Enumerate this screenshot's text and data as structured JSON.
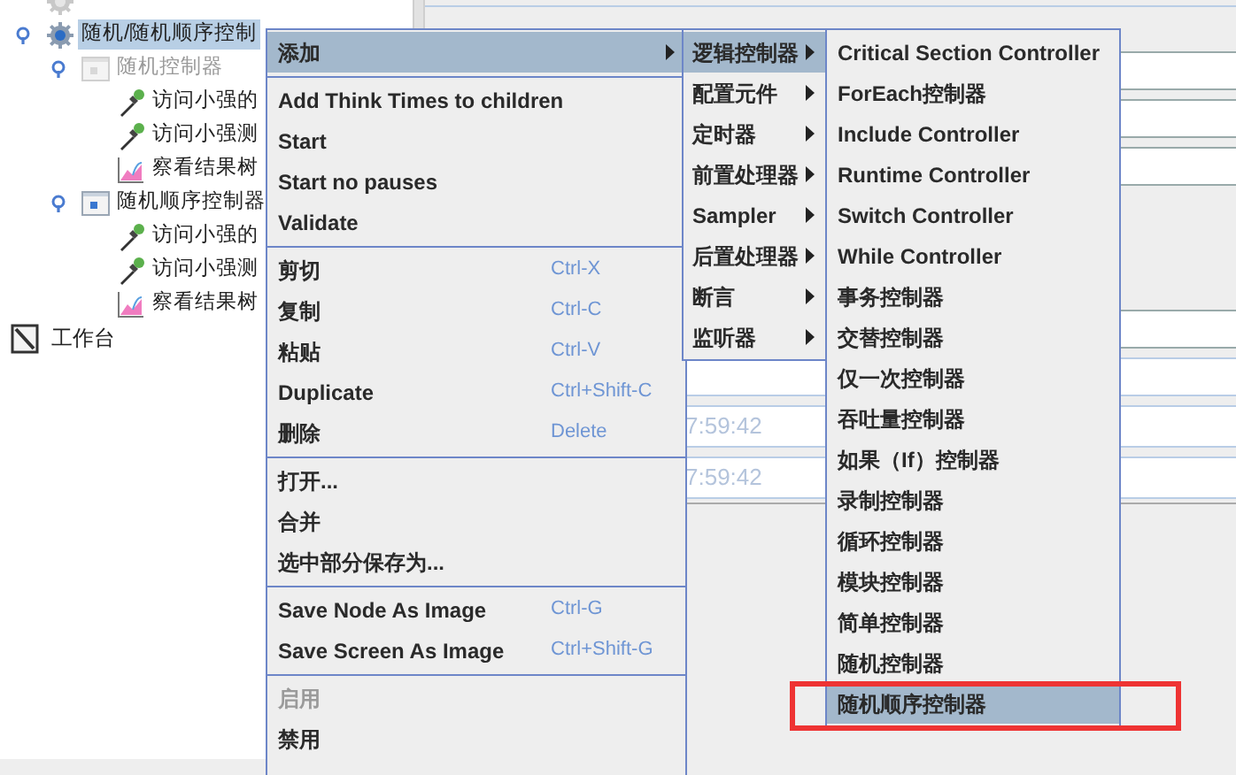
{
  "tree": {
    "items": [
      {
        "kind": "gear",
        "disabled": true
      },
      {
        "label": "随机/随机顺序控制",
        "kind": "gear",
        "disabled": false,
        "selected": true,
        "children": [
          {
            "label": "随机控制器",
            "kind": "controller",
            "disabled": true,
            "selected": false,
            "children": [
              {
                "label": "访问小强的",
                "kind": "sampler",
                "disabled": false,
                "selected": false
              },
              {
                "label": "访问小强测",
                "kind": "sampler",
                "disabled": false,
                "selected": false
              },
              {
                "label": "察看结果树",
                "kind": "listener",
                "disabled": false,
                "selected": false
              }
            ]
          },
          {
            "label": "随机顺序控制器",
            "kind": "controller",
            "disabled": false,
            "selected": false,
            "children": [
              {
                "label": "访问小强的",
                "kind": "sampler",
                "disabled": false,
                "selected": false
              },
              {
                "label": "访问小强测",
                "kind": "sampler",
                "disabled": false,
                "selected": false
              },
              {
                "label": "察看结果树",
                "kind": "listener",
                "disabled": false,
                "selected": false
              }
            ]
          }
        ]
      }
    ],
    "workbench": {
      "label": "工作台",
      "kind": "workbench"
    }
  },
  "details": {
    "times": [
      "7:59:42",
      "7:59:42"
    ]
  },
  "menus": [
    {
      "items": [
        {
          "kind": "item",
          "label": "添加",
          "submenu": true,
          "selected": true,
          "disabled": false
        },
        {
          "kind": "separator"
        },
        {
          "kind": "item",
          "label": "Add Think Times to children",
          "submenu": false,
          "selected": false,
          "disabled": false
        },
        {
          "kind": "item",
          "label": "Start",
          "submenu": false,
          "selected": false,
          "disabled": false
        },
        {
          "kind": "item",
          "label": "Start no pauses",
          "submenu": false,
          "selected": false,
          "disabled": false
        },
        {
          "kind": "item",
          "label": "Validate",
          "submenu": false,
          "selected": false,
          "disabled": false
        },
        {
          "kind": "separator"
        },
        {
          "kind": "item",
          "label": "剪切",
          "shortcut": "Ctrl-X",
          "submenu": false,
          "selected": false,
          "disabled": false
        },
        {
          "kind": "item",
          "label": "复制",
          "shortcut": "Ctrl-C",
          "submenu": false,
          "selected": false,
          "disabled": false
        },
        {
          "kind": "item",
          "label": "粘贴",
          "shortcut": "Ctrl-V",
          "submenu": false,
          "selected": false,
          "disabled": false
        },
        {
          "kind": "item",
          "label": "Duplicate",
          "shortcut": "Ctrl+Shift-C",
          "submenu": false,
          "selected": false,
          "disabled": false
        },
        {
          "kind": "item",
          "label": "删除",
          "shortcut": "Delete",
          "submenu": false,
          "selected": false,
          "disabled": false
        },
        {
          "kind": "separator"
        },
        {
          "kind": "item",
          "label": "打开...",
          "submenu": false,
          "selected": false,
          "disabled": false
        },
        {
          "kind": "item",
          "label": "合并",
          "submenu": false,
          "selected": false,
          "disabled": false
        },
        {
          "kind": "item",
          "label": "选中部分保存为...",
          "submenu": false,
          "selected": false,
          "disabled": false
        },
        {
          "kind": "separator"
        },
        {
          "kind": "item",
          "label": "Save Node As Image",
          "shortcut": "Ctrl-G",
          "submenu": false,
          "selected": false,
          "disabled": false
        },
        {
          "kind": "item",
          "label": "Save Screen As Image",
          "shortcut": "Ctrl+Shift-G",
          "submenu": false,
          "selected": false,
          "disabled": false
        },
        {
          "kind": "separator"
        },
        {
          "kind": "item",
          "label": "启用",
          "submenu": false,
          "selected": false,
          "disabled": true
        },
        {
          "kind": "item",
          "label": "禁用",
          "submenu": false,
          "selected": false,
          "disabled": false
        }
      ]
    },
    {
      "items": [
        {
          "kind": "item",
          "label": "逻辑控制器",
          "submenu": true,
          "selected": true,
          "disabled": false
        },
        {
          "kind": "item",
          "label": "配置元件",
          "submenu": true,
          "selected": false,
          "disabled": false
        },
        {
          "kind": "item",
          "label": "定时器",
          "submenu": true,
          "selected": false,
          "disabled": false
        },
        {
          "kind": "item",
          "label": "前置处理器",
          "submenu": true,
          "selected": false,
          "disabled": false
        },
        {
          "kind": "item",
          "label": "Sampler",
          "submenu": true,
          "selected": false,
          "disabled": false
        },
        {
          "kind": "item",
          "label": "后置处理器",
          "submenu": true,
          "selected": false,
          "disabled": false
        },
        {
          "kind": "item",
          "label": "断言",
          "submenu": true,
          "selected": false,
          "disabled": false
        },
        {
          "kind": "item",
          "label": "监听器",
          "submenu": true,
          "selected": false,
          "disabled": false
        }
      ]
    },
    {
      "items": [
        {
          "kind": "item",
          "label": "Critical Section Controller",
          "selected": false,
          "annotated": false
        },
        {
          "kind": "item",
          "label": "ForEach控制器",
          "selected": false,
          "annotated": false
        },
        {
          "kind": "item",
          "label": "Include Controller",
          "selected": false,
          "annotated": false
        },
        {
          "kind": "item",
          "label": "Runtime Controller",
          "selected": false,
          "annotated": false
        },
        {
          "kind": "item",
          "label": "Switch Controller",
          "selected": false,
          "annotated": false
        },
        {
          "kind": "item",
          "label": "While Controller",
          "selected": false,
          "annotated": false
        },
        {
          "kind": "item",
          "label": "事务控制器",
          "selected": false,
          "annotated": false
        },
        {
          "kind": "item",
          "label": "交替控制器",
          "selected": false,
          "annotated": false
        },
        {
          "kind": "item",
          "label": "仅一次控制器",
          "selected": false,
          "annotated": false
        },
        {
          "kind": "item",
          "label": "吞吐量控制器",
          "selected": false,
          "annotated": false
        },
        {
          "kind": "item",
          "label": "如果（If）控制器",
          "selected": false,
          "annotated": false
        },
        {
          "kind": "item",
          "label": "录制控制器",
          "selected": false,
          "annotated": false
        },
        {
          "kind": "item",
          "label": "循环控制器",
          "selected": false,
          "annotated": false
        },
        {
          "kind": "item",
          "label": "模块控制器",
          "selected": false,
          "annotated": false
        },
        {
          "kind": "item",
          "label": "简单控制器",
          "selected": false,
          "annotated": false
        },
        {
          "kind": "item",
          "label": "随机控制器",
          "selected": false,
          "annotated": false
        },
        {
          "kind": "item",
          "label": "随机顺序控制器",
          "selected": true,
          "annotated": true
        }
      ]
    }
  ]
}
